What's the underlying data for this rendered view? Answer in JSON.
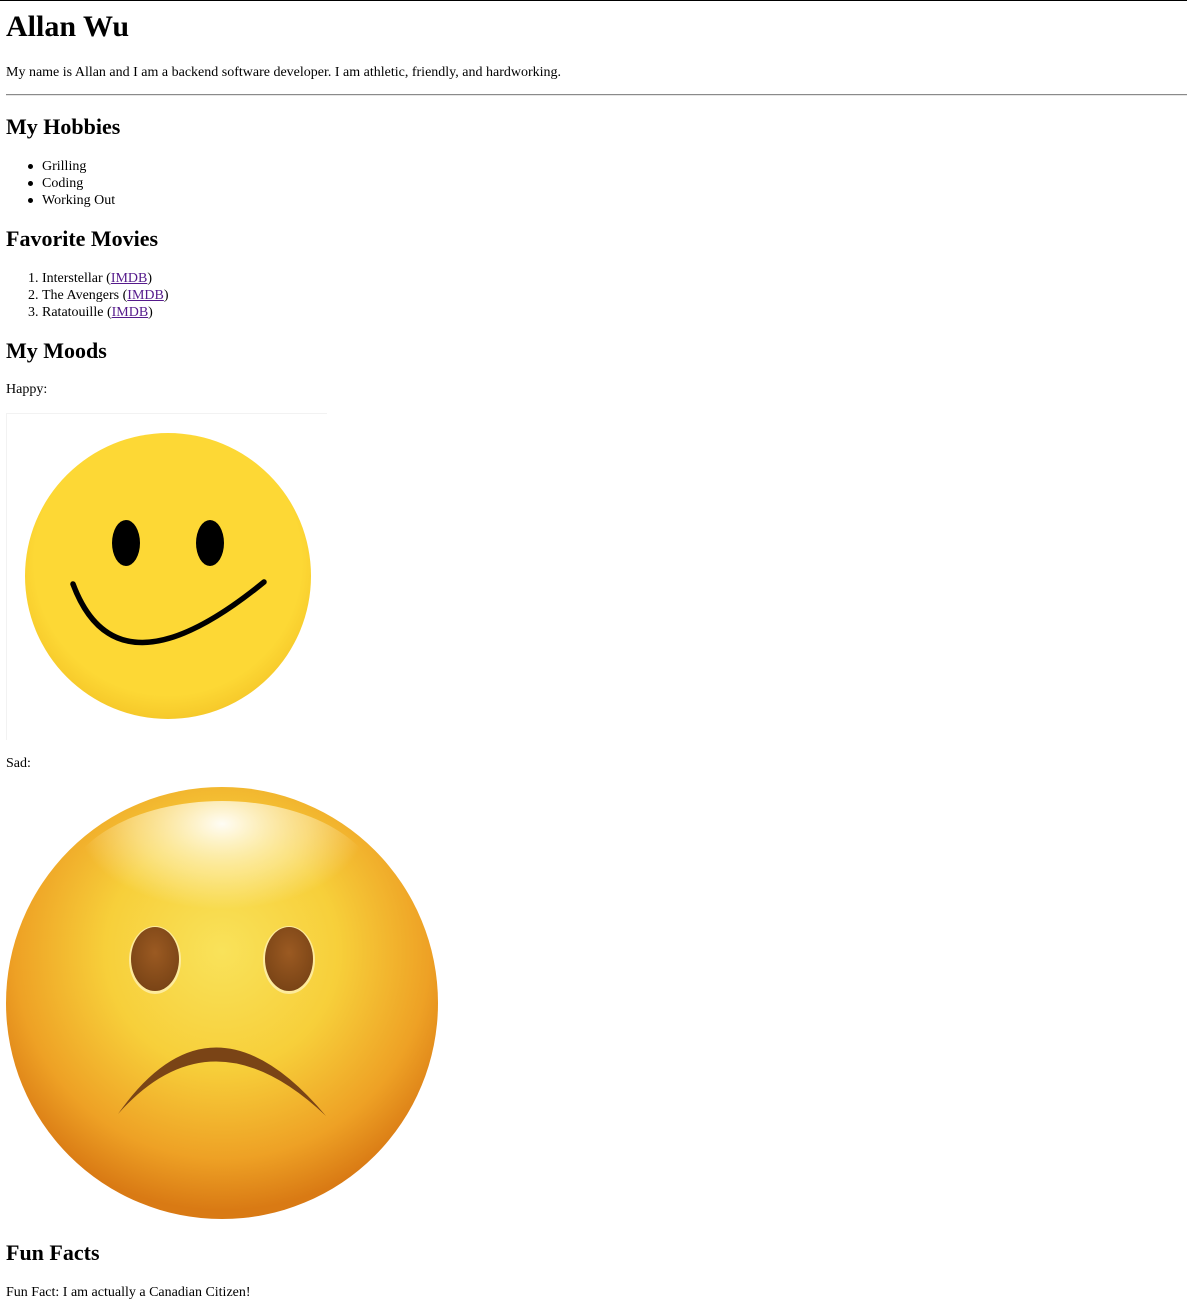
{
  "header": {
    "name": "Allan Wu",
    "intro": "My name is Allan and I am a backend software developer. I am athletic, friendly, and hardworking."
  },
  "hobbies": {
    "heading": "My Hobbies",
    "items": [
      "Grilling",
      "Coding",
      "Working Out"
    ]
  },
  "movies": {
    "heading": "Favorite Movies",
    "items": [
      {
        "number": "1.",
        "title": "Interstellar",
        "link": "IMDB"
      },
      {
        "number": "2.",
        "title": "The Avengers",
        "link": "IMDB"
      },
      {
        "number": "3.",
        "title": "Ratatouille",
        "link": "IMDB"
      }
    ]
  },
  "moods": {
    "heading": "My Moods",
    "happy_label": "Happy:",
    "sad_label": "Sad:"
  },
  "fun_facts": {
    "heading": "Fun Facts",
    "text": "Fun Fact: I am actually a Canadian Citizen!"
  },
  "colors": {
    "happy_face": "#fdd835",
    "sad_face_edge": "#d97a14",
    "sad_face_center": "#f9e25a",
    "sad_features": "#7a4416",
    "link_visited": "#551a8b"
  }
}
